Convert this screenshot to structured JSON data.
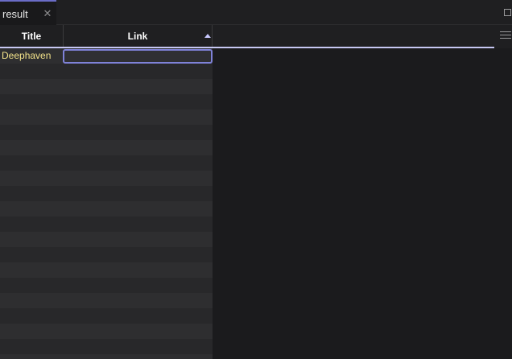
{
  "panel": {
    "tab_label": "result",
    "close_glyph": "✕"
  },
  "grid": {
    "columns": [
      {
        "label": "Title"
      },
      {
        "label": "Link",
        "sort": "ascending"
      }
    ],
    "rows": [
      {
        "title": "Deephaven",
        "link": ""
      }
    ]
  },
  "colors": {
    "accent": "#7f82d8",
    "title_text": "#f2e28a"
  },
  "icons": {
    "sort": "sort-ascending-icon",
    "menu": "hamburger-menu-icon",
    "maximize": "maximize-icon",
    "close": "close-icon"
  }
}
